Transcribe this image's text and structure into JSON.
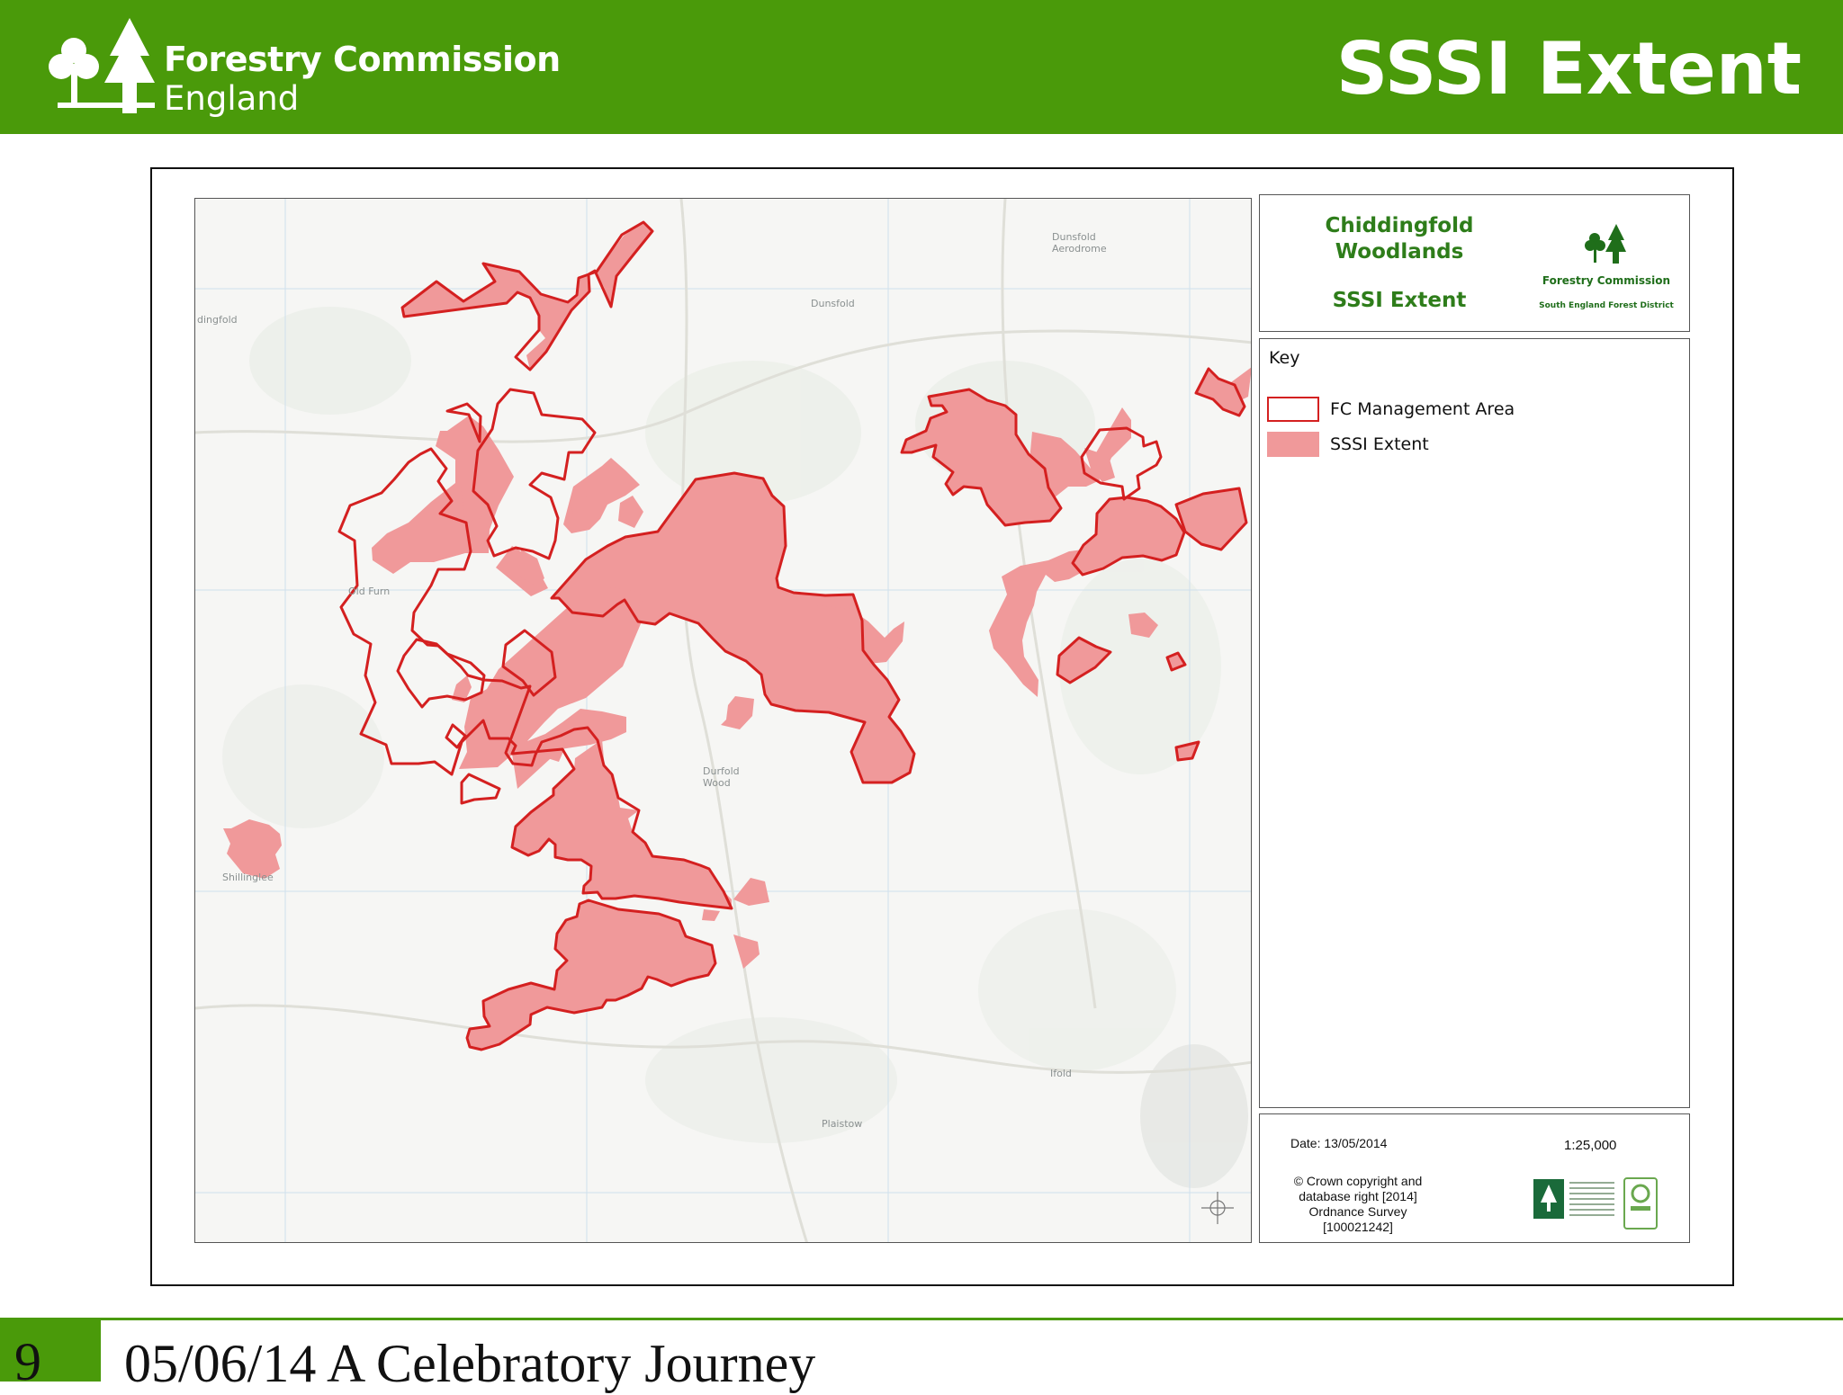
{
  "header": {
    "org_line1": "Forestry Commission",
    "org_line2": "England",
    "title": "SSSI Extent"
  },
  "map_panel": {
    "title_lines": [
      "Chiddingfold",
      "Woodlands"
    ],
    "subtitle": "SSSI Extent",
    "logo_text": "Forestry Commission",
    "district": "South England Forest District"
  },
  "key": {
    "heading": "Key",
    "items": [
      {
        "label": "FC Management Area",
        "fill": "#ffffff",
        "stroke": "#d42020"
      },
      {
        "label": "SSSI Extent",
        "fill": "#f0999a",
        "stroke": "none"
      }
    ]
  },
  "info": {
    "date": "Date: 13/05/2014",
    "scale": "1:25,000",
    "copyright_lines": [
      "© Crown copyright and",
      "database right [2014]",
      "Ordnance Survey",
      "[100021242]"
    ]
  },
  "map_labels": {
    "dunsfold_aerodrome": [
      "Dunsfold",
      "Aerodrome"
    ],
    "dunsfold": "Dunsfold",
    "chiddingfold_edge": "dingfold",
    "old_furnace": "Old Furn",
    "durfold_wood": [
      "Durfold",
      "Wood"
    ],
    "plaistow": "Plaistow",
    "ifold": "Ifold",
    "shillinglee": "Shillinglee"
  },
  "colors": {
    "header_green": "#4a9a0a",
    "panel_green": "#2e7d1a",
    "fc_outline": "#d42020",
    "sssi_fill": "#f0999a"
  },
  "footer": {
    "page_number": "9",
    "text": "05/06/14   A Celebratory Journey"
  }
}
